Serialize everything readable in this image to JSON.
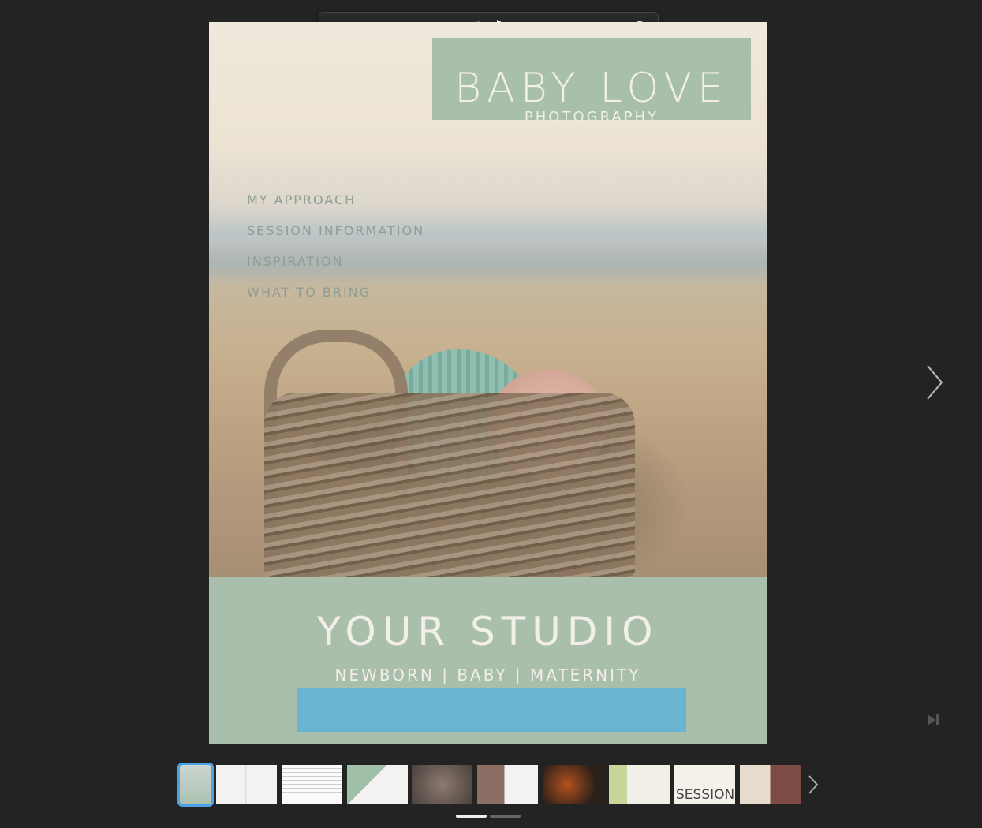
{
  "toolbar": {
    "zoom_level": 0.1,
    "icons": [
      "zoom-out-icon",
      "zoom-slider",
      "two-page-icon",
      "previous-page-icon",
      "play-icon",
      "search-icon",
      "thumbnails-icon",
      "share-icon",
      "close-icon"
    ]
  },
  "page": {
    "logo": {
      "title": "BABY LOVE",
      "subtitle": "PHOTOGRAPHY"
    },
    "menu": [
      "MY APPROACH",
      "SESSION INFORMATION",
      "INSPIRATION",
      "WHAT TO BRING"
    ],
    "studio_name": "YOUR STUDIO",
    "tagline": "NEWBORN | BABY | MATERNITY",
    "colors": {
      "accent_green": "#a9bfac",
      "accent_blue": "#69b4d1",
      "background": "#232323"
    }
  },
  "thumbnails": {
    "count": 10,
    "selected": 1,
    "labels": [
      "",
      "",
      "",
      "",
      "",
      "",
      "",
      "",
      "SESSION",
      ""
    ]
  },
  "pager": {
    "pages": 2,
    "current": 1
  }
}
